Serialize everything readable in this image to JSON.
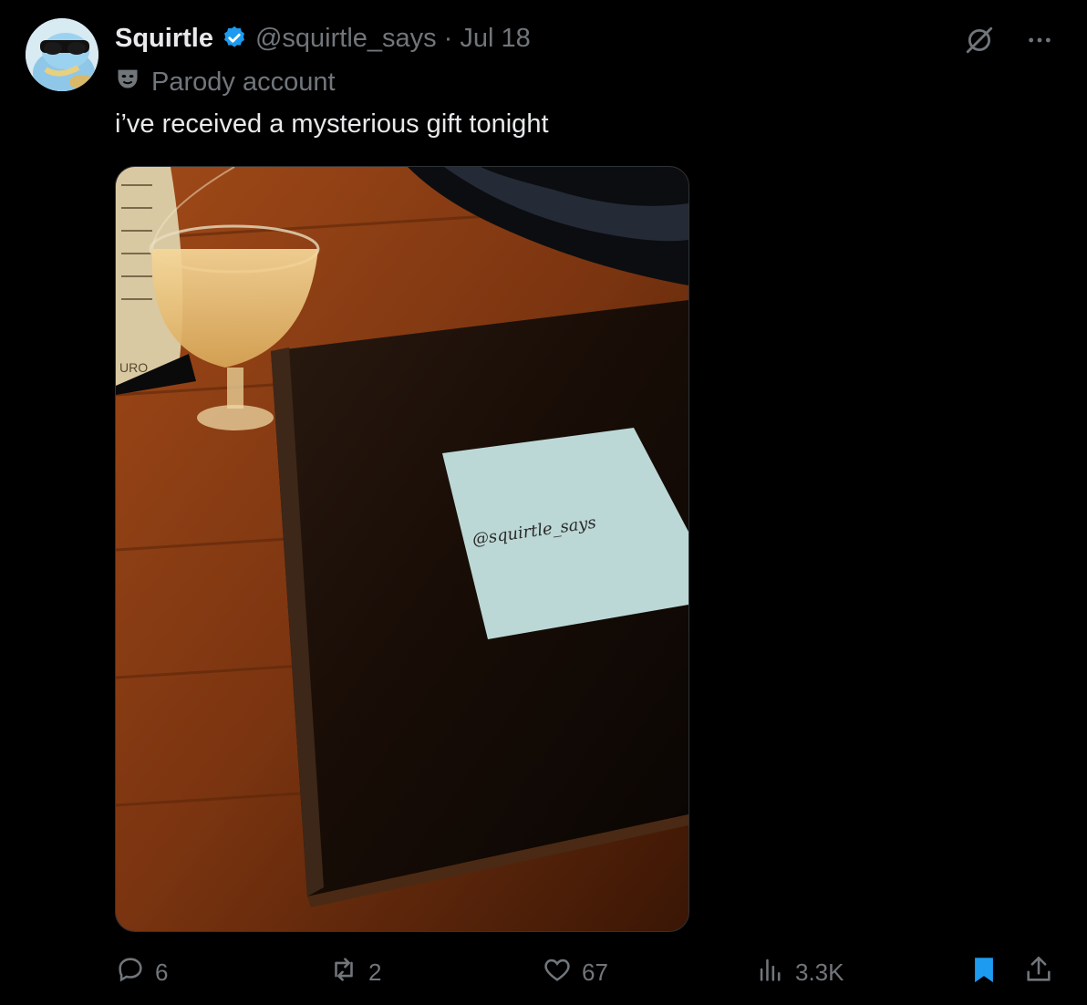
{
  "tweet": {
    "author_name": "Squirtle",
    "handle": "@squirtle_says",
    "separator": "·",
    "date": "Jul 18",
    "parody_label": "Parody account",
    "text": "i’ve received a mysterious gift tonight"
  },
  "image": {
    "note_text": "@squirtle_says",
    "menu_fragment": "URO"
  },
  "actions": {
    "replies": "6",
    "reposts": "2",
    "likes": "67",
    "views": "3.3K"
  },
  "colors": {
    "background": "#000000",
    "text": "#e7e9ea",
    "muted": "#71767b",
    "verified": "#1d9bf0",
    "bookmark": "#1d9bf0"
  },
  "icons": {
    "verified": "verified-badge-icon",
    "parody": "parody-mask-icon",
    "grok": "grok-icon",
    "more": "more-icon",
    "reply": "reply-icon",
    "repost": "repost-icon",
    "like": "like-icon",
    "views": "views-icon",
    "bookmark": "bookmark-icon",
    "share": "share-icon"
  }
}
